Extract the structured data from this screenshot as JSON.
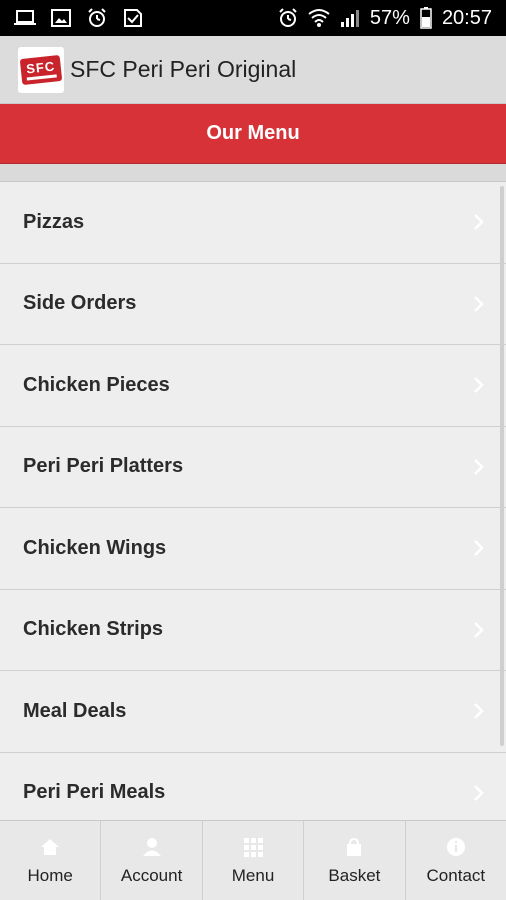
{
  "statusbar": {
    "left_icons": [
      "laptop-icon",
      "image-icon",
      "alarm-icon",
      "app-check-icon"
    ],
    "right_icons": [
      "alarm-icon",
      "wifi-icon",
      "signal-icon",
      "battery-icon"
    ],
    "battery": "57%",
    "time": "20:57"
  },
  "appbar": {
    "logo_text": "SFC",
    "title": "SFC Peri Peri Original"
  },
  "header": {
    "title": "Our Menu"
  },
  "menu": {
    "items": [
      {
        "label": "Pizzas"
      },
      {
        "label": "Side Orders"
      },
      {
        "label": "Chicken Pieces"
      },
      {
        "label": "Peri Peri Platters"
      },
      {
        "label": "Chicken Wings"
      },
      {
        "label": "Chicken Strips"
      },
      {
        "label": "Meal Deals"
      },
      {
        "label": "Peri Peri Meals"
      }
    ]
  },
  "tabbar": {
    "tabs": [
      {
        "label": "Home",
        "icon": "home-icon"
      },
      {
        "label": "Account",
        "icon": "user-icon"
      },
      {
        "label": "Menu",
        "icon": "grid-icon"
      },
      {
        "label": "Basket",
        "icon": "basket-icon"
      },
      {
        "label": "Contact",
        "icon": "info-icon"
      }
    ]
  },
  "colors": {
    "accent_red": "#d63238",
    "appbar_bg": "#dcdcdc",
    "list_bg": "#eeeeee"
  }
}
